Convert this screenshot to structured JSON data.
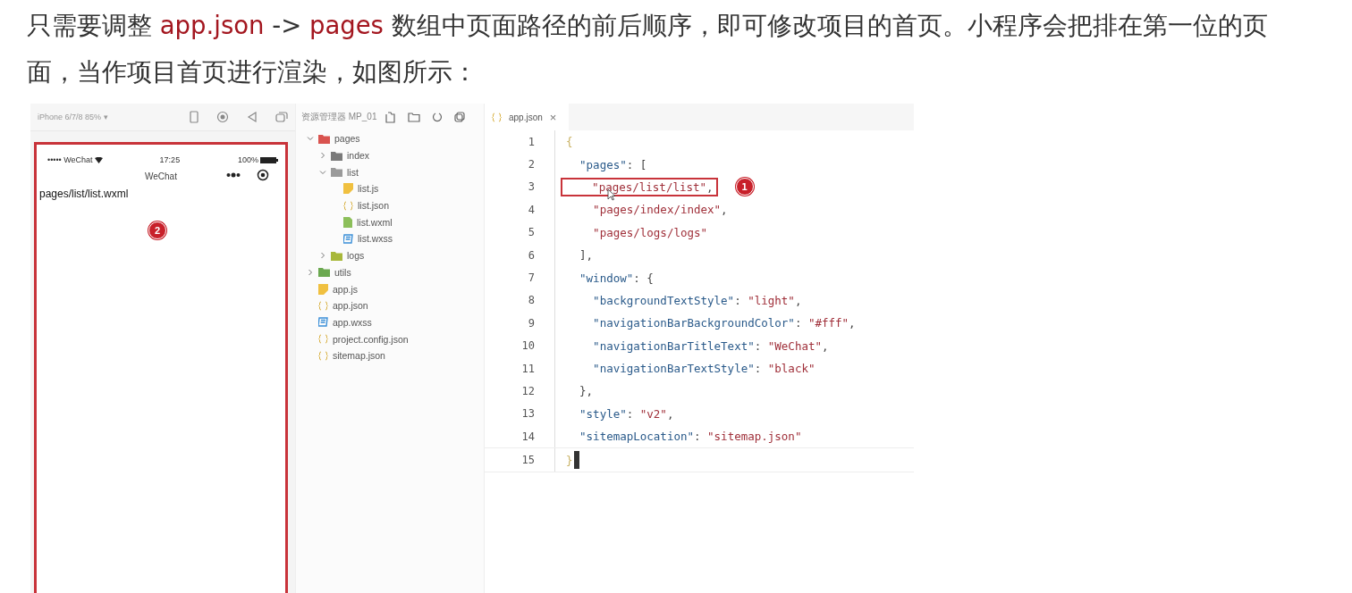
{
  "paragraph": [
    {
      "kind": "plain",
      "text": "只需要调整 "
    },
    {
      "kind": "code",
      "text": "app.json"
    },
    {
      "kind": "plain",
      "text": " -> "
    },
    {
      "kind": "code",
      "text": "pages"
    },
    {
      "kind": "plain",
      "text": " 数组中页面路径的前后顺序，即可修改项目的首页。小程序会把排在第一位的页面，当作项目首页进行渲染，如图所示："
    }
  ],
  "simulator": {
    "device": "iPhone 6/7/8 85% ▾",
    "status_bar": {
      "carrier": "••••• WeChat",
      "time": "17:25",
      "battery": "100%"
    },
    "nav_title": "WeChat",
    "page_text": "pages/list/list.wxml",
    "marker": "2"
  },
  "explorer": {
    "title": "资源管理器 MP_01",
    "tree": [
      {
        "name": "pages",
        "kind": "folder",
        "color": "#d9534f",
        "expanded": true,
        "children": [
          {
            "name": "index",
            "kind": "folder",
            "color": "#7a7a7a",
            "expanded": false
          },
          {
            "name": "list",
            "kind": "folder",
            "color": "#9a9a9a",
            "expanded": true,
            "children": [
              {
                "name": "list.js",
                "kind": "js"
              },
              {
                "name": "list.json",
                "kind": "json"
              },
              {
                "name": "list.wxml",
                "kind": "wxml"
              },
              {
                "name": "list.wxss",
                "kind": "wxss"
              }
            ]
          },
          {
            "name": "logs",
            "kind": "folder",
            "color": "#a8b83a",
            "expanded": false
          }
        ]
      },
      {
        "name": "utils",
        "kind": "folder",
        "color": "#6aa84f",
        "expanded": false
      },
      {
        "name": "app.js",
        "kind": "js"
      },
      {
        "name": "app.json",
        "kind": "json"
      },
      {
        "name": "app.wxss",
        "kind": "wxss"
      },
      {
        "name": "project.config.json",
        "kind": "json"
      },
      {
        "name": "sitemap.json",
        "kind": "json"
      }
    ]
  },
  "editor": {
    "tab": {
      "label": "app.json",
      "close": "×"
    },
    "marker": "1",
    "lines": [
      {
        "number": "1",
        "tokens": [
          {
            "kind": "brace",
            "text": "{"
          }
        ]
      },
      {
        "number": "2",
        "tokens": [
          {
            "kind": "key",
            "text": "  \"pages\""
          },
          {
            "kind": "punct",
            "text": ": ["
          }
        ]
      },
      {
        "number": "3",
        "highlight": true,
        "tokens": [
          {
            "kind": "string",
            "text": "    \"pages/list/list\""
          },
          {
            "kind": "punct",
            "text": ","
          }
        ]
      },
      {
        "number": "4",
        "tokens": [
          {
            "kind": "string",
            "text": "    \"pages/index/index\""
          },
          {
            "kind": "punct",
            "text": ","
          }
        ]
      },
      {
        "number": "5",
        "tokens": [
          {
            "kind": "string",
            "text": "    \"pages/logs/logs\""
          }
        ]
      },
      {
        "number": "6",
        "tokens": [
          {
            "kind": "punct",
            "text": "  ],"
          }
        ]
      },
      {
        "number": "7",
        "tokens": [
          {
            "kind": "key",
            "text": "  \"window\""
          },
          {
            "kind": "punct",
            "text": ": {"
          }
        ]
      },
      {
        "number": "8",
        "tokens": [
          {
            "kind": "key",
            "text": "    \"backgroundTextStyle\""
          },
          {
            "kind": "punct",
            "text": ": "
          },
          {
            "kind": "string",
            "text": "\"light\""
          },
          {
            "kind": "punct",
            "text": ","
          }
        ]
      },
      {
        "number": "9",
        "tokens": [
          {
            "kind": "key",
            "text": "    \"navigationBarBackgroundColor\""
          },
          {
            "kind": "punct",
            "text": ": "
          },
          {
            "kind": "string",
            "text": "\"#fff\""
          },
          {
            "kind": "punct",
            "text": ","
          }
        ]
      },
      {
        "number": "10",
        "tokens": [
          {
            "kind": "key",
            "text": "    \"navigationBarTitleText\""
          },
          {
            "kind": "punct",
            "text": ": "
          },
          {
            "kind": "string",
            "text": "\"WeChat\""
          },
          {
            "kind": "punct",
            "text": ","
          }
        ]
      },
      {
        "number": "11",
        "tokens": [
          {
            "kind": "key",
            "text": "    \"navigationBarTextStyle\""
          },
          {
            "kind": "punct",
            "text": ": "
          },
          {
            "kind": "string",
            "text": "\"black\""
          }
        ]
      },
      {
        "number": "12",
        "tokens": [
          {
            "kind": "punct",
            "text": "  },"
          }
        ]
      },
      {
        "number": "13",
        "tokens": [
          {
            "kind": "key",
            "text": "  \"style\""
          },
          {
            "kind": "punct",
            "text": ": "
          },
          {
            "kind": "string",
            "text": "\"v2\""
          },
          {
            "kind": "punct",
            "text": ","
          }
        ]
      },
      {
        "number": "14",
        "tokens": [
          {
            "kind": "key",
            "text": "  \"sitemapLocation\""
          },
          {
            "kind": "punct",
            "text": ": "
          },
          {
            "kind": "string",
            "text": "\"sitemap.json\""
          }
        ]
      },
      {
        "number": "15",
        "cursor": true,
        "tokens": [
          {
            "kind": "brace",
            "text": "}"
          }
        ]
      }
    ]
  }
}
